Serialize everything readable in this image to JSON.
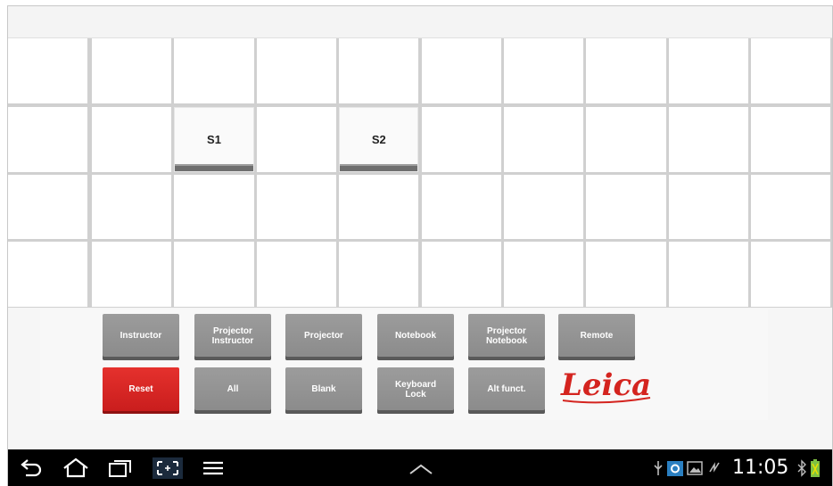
{
  "grid": {
    "rows": 4,
    "cols": 10,
    "seats": [
      {
        "label": "S1",
        "row": 1,
        "col": 2
      },
      {
        "label": "S2",
        "row": 1,
        "col": 4
      }
    ]
  },
  "controls": {
    "row1": [
      "Instructor",
      "Projector\nInstructor",
      "Projector",
      "Notebook",
      "Projector\nNotebook",
      "Remote"
    ],
    "row2": [
      "Reset",
      "All",
      "Blank",
      "Keyboard\nLock",
      "Alt funct."
    ]
  },
  "logo": {
    "text": "Leica"
  },
  "statusbar": {
    "time": "11:05"
  },
  "colors": {
    "reset": "#d62a26",
    "button": "#939393",
    "logo": "#d4241f"
  },
  "icons": [
    "back-icon",
    "home-icon",
    "recent-apps-icon",
    "screenshot-icon",
    "menu-icon",
    "chevron-up-icon",
    "usb-icon",
    "skype-icon",
    "gallery-icon",
    "sync-icon",
    "bluetooth-icon",
    "battery-icon"
  ]
}
